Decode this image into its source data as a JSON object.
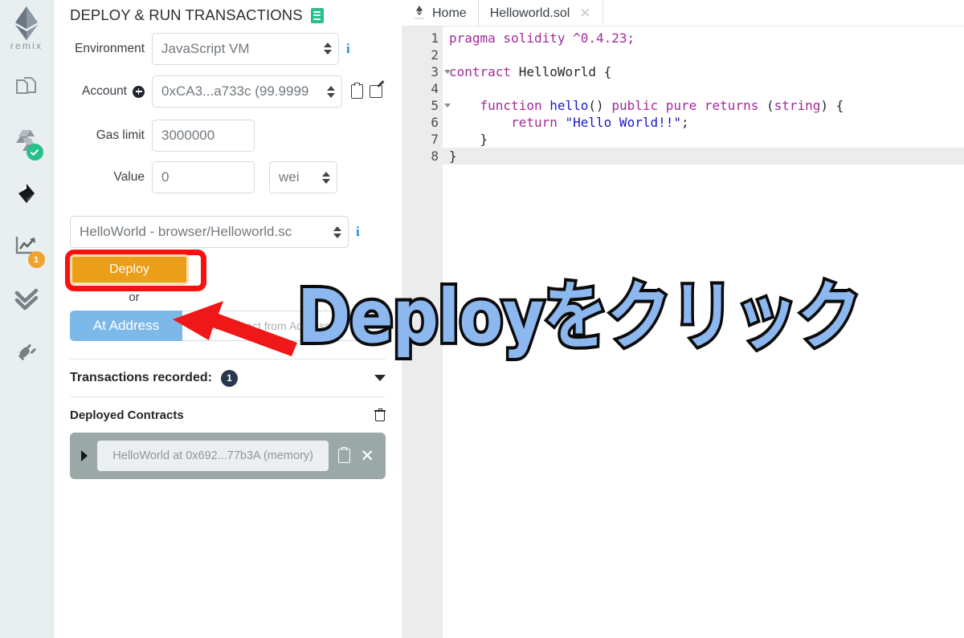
{
  "iconbar": {
    "logo_label": "remix",
    "items": [
      {
        "name": "file-explorers-icon",
        "badge": null
      },
      {
        "name": "solidity-compiler-icon",
        "badge": "check"
      },
      {
        "name": "deploy-run-transactions-icon",
        "badge": null
      },
      {
        "name": "debugger-icon",
        "badge": "1"
      },
      {
        "name": "analysis-icon",
        "badge": null
      },
      {
        "name": "plugin-manager-icon",
        "badge": null
      }
    ],
    "debugger_badge_count": "1"
  },
  "panel": {
    "title": "DEPLOY & RUN TRANSACTIONS",
    "fields": {
      "environment_label": "Environment",
      "environment_value": "JavaScript VM",
      "account_label": "Account",
      "account_value": "0xCA3...a733c (99.9999",
      "gas_label": "Gas limit",
      "gas_value": "3000000",
      "value_label": "Value",
      "value_value": "0",
      "unit_value": "wei"
    },
    "contract_select_value": "HelloWorld - browser/Helloworld.sc",
    "deploy_button": "Deploy",
    "or_text": "or",
    "at_address_button": "At Address",
    "at_address_placeholder": "Load contract from Address",
    "transactions_recorded_label": "Transactions recorded:",
    "transactions_recorded_count": "1",
    "deployed_contracts_label": "Deployed Contracts",
    "deployed_contract_item": "HelloWorld at 0x692...77b3A (memory)"
  },
  "editor": {
    "tabs": [
      {
        "label": "Home",
        "closable": false,
        "active": false
      },
      {
        "label": "Helloworld.sol",
        "closable": true,
        "active": true
      }
    ],
    "close_glyph": "✕",
    "lines": [
      {
        "n": "1",
        "fold": false,
        "active": false,
        "tokens": [
          {
            "t": "pragma solidity ",
            "c": "kw"
          },
          {
            "t": "^0.4.23;",
            "c": "kw"
          }
        ]
      },
      {
        "n": "2",
        "fold": false,
        "active": false,
        "tokens": [
          {
            "t": "",
            "c": "pl"
          }
        ]
      },
      {
        "n": "3",
        "fold": true,
        "active": false,
        "tokens": [
          {
            "t": "contract ",
            "c": "kw"
          },
          {
            "t": "HelloWorld",
            "c": "pl"
          },
          {
            "t": " {",
            "c": "pl"
          }
        ]
      },
      {
        "n": "4",
        "fold": false,
        "active": false,
        "tokens": [
          {
            "t": "",
            "c": "pl"
          }
        ]
      },
      {
        "n": "5",
        "fold": true,
        "active": false,
        "tokens": [
          {
            "t": "    function ",
            "c": "kw"
          },
          {
            "t": "hello",
            "c": "id"
          },
          {
            "t": "() ",
            "c": "pl"
          },
          {
            "t": "public pure returns ",
            "c": "kw"
          },
          {
            "t": "(",
            "c": "pl"
          },
          {
            "t": "string",
            "c": "kw"
          },
          {
            "t": ") {",
            "c": "pl"
          }
        ]
      },
      {
        "n": "6",
        "fold": false,
        "active": false,
        "tokens": [
          {
            "t": "        return ",
            "c": "kw"
          },
          {
            "t": "\"Hello World!!\"",
            "c": "st"
          },
          {
            "t": ";",
            "c": "pl"
          }
        ]
      },
      {
        "n": "7",
        "fold": false,
        "active": false,
        "tokens": [
          {
            "t": "    }",
            "c": "pl"
          }
        ]
      },
      {
        "n": "8",
        "fold": false,
        "active": true,
        "tokens": [
          {
            "t": "}",
            "c": "pl"
          }
        ]
      }
    ]
  },
  "annotation": {
    "text": "Deployをクリック",
    "arrow_color": "#ef1717",
    "highlight_color": "#fb1010",
    "text_fill": "#8cb8ef",
    "text_stroke": "#0b0b0b"
  },
  "colors": {
    "deploy_orange": "#eb9e17",
    "at_address_blue": "#7db9e8",
    "badge_green": "#26c08a",
    "badge_orange": "#f0a32b",
    "count_badge_navy": "#27374d",
    "deployed_item_bg": "#9aa9a7",
    "info_blue": "#1f8ceb",
    "keyword_magenta": "#a32a9a",
    "identifier_blue": "#1717c9"
  }
}
